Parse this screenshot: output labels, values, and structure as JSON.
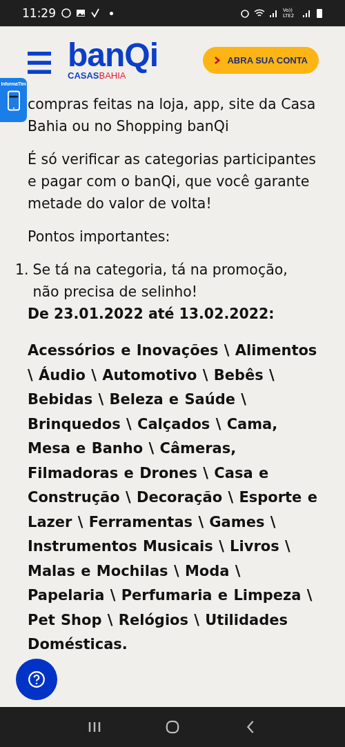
{
  "status_bar": {
    "time": "11:29",
    "network": "Vo)) LTE2"
  },
  "header": {
    "logo": {
      "brand": "banQi",
      "sub_brand_left": "CASAS",
      "sub_brand_right": "BAHIA"
    },
    "cta": "ABRA SUA CONTA"
  },
  "side_widget": {
    "label": "InformaTim"
  },
  "article": {
    "paragraphs": [
      "compras feitas na loja, app, site da Casa Bahia ou no Shopping banQi",
      "É só verificar as categorias participantes e pagar com o banQi, que você garante metade do valor de volta!",
      "Pontos importantes:"
    ],
    "list": [
      {
        "number": "1.",
        "text": "Se tá na categoria, tá na promoção, não precisa de selinho!"
      }
    ],
    "period": "De 23.01.2022 até 13.02.2022:",
    "categories": "Acessórios e Inovações \\ Alimentos \\ Áudio \\ Automotivo \\ Bebês \\ Bebidas \\ Beleza e Saúde \\ Brinquedos \\ Calçados \\ Cama, Mesa e Banho \\ Câmeras, Filmadoras e Drones \\ Casa e Construção \\ Decoração \\ Esporte e Lazer \\ Ferramentas \\ Games \\ Instrumentos Musicais \\ Livros \\ Malas e Mochilas \\ Moda \\ Papelaria \\ Perfumaria e Limpeza \\ Pet Shop \\ Relógios \\ Utilidades Domésticas."
  }
}
